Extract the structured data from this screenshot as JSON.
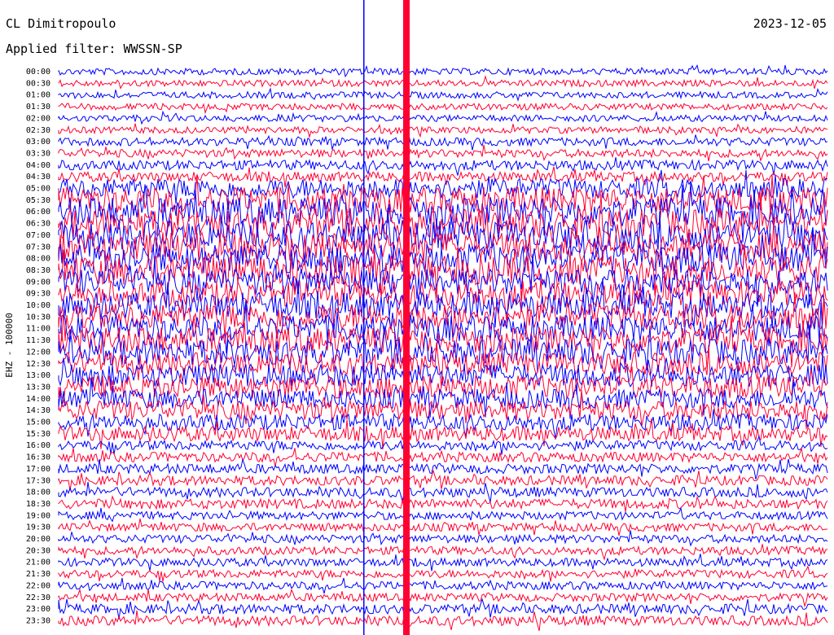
{
  "header": {
    "station": "CL Dimitropoulo",
    "date": "2023-12-05",
    "filter": "Applied filter: WWSSN-SP"
  },
  "colors": {
    "a": "#0000ff",
    "b": "#ff0033"
  },
  "chart_data": {
    "type": "line",
    "title": "CL Dimitropoulo",
    "ylabel": "EHZ - 100000",
    "row_labels": [
      "00:00",
      "00:30",
      "01:00",
      "01:30",
      "02:00",
      "02:30",
      "03:00",
      "03:30",
      "04:00",
      "04:30",
      "05:00",
      "05:30",
      "06:00",
      "06:30",
      "07:00",
      "07:30",
      "08:00",
      "08:30",
      "09:00",
      "09:30",
      "10:00",
      "10:30",
      "11:00",
      "11:30",
      "12:00",
      "12:30",
      "13:00",
      "13:30",
      "14:00",
      "14:30",
      "15:00",
      "15:30",
      "16:00",
      "16:30",
      "17:00",
      "17:30",
      "18:00",
      "18:30",
      "19:00",
      "19:30",
      "20:00",
      "20:30",
      "21:00",
      "21:30",
      "22:00",
      "22:30",
      "23:00",
      "23:30"
    ],
    "row_amplitude": [
      4,
      4,
      4,
      4,
      4,
      4,
      5,
      5,
      6,
      6,
      12,
      16,
      18,
      18,
      18,
      18,
      18,
      18,
      16,
      16,
      16,
      16,
      16,
      16,
      16,
      14,
      14,
      14,
      12,
      12,
      10,
      9,
      6,
      6,
      6,
      6,
      6,
      6,
      5,
      5,
      5,
      5,
      5,
      5,
      5,
      5,
      6,
      6
    ]
  }
}
